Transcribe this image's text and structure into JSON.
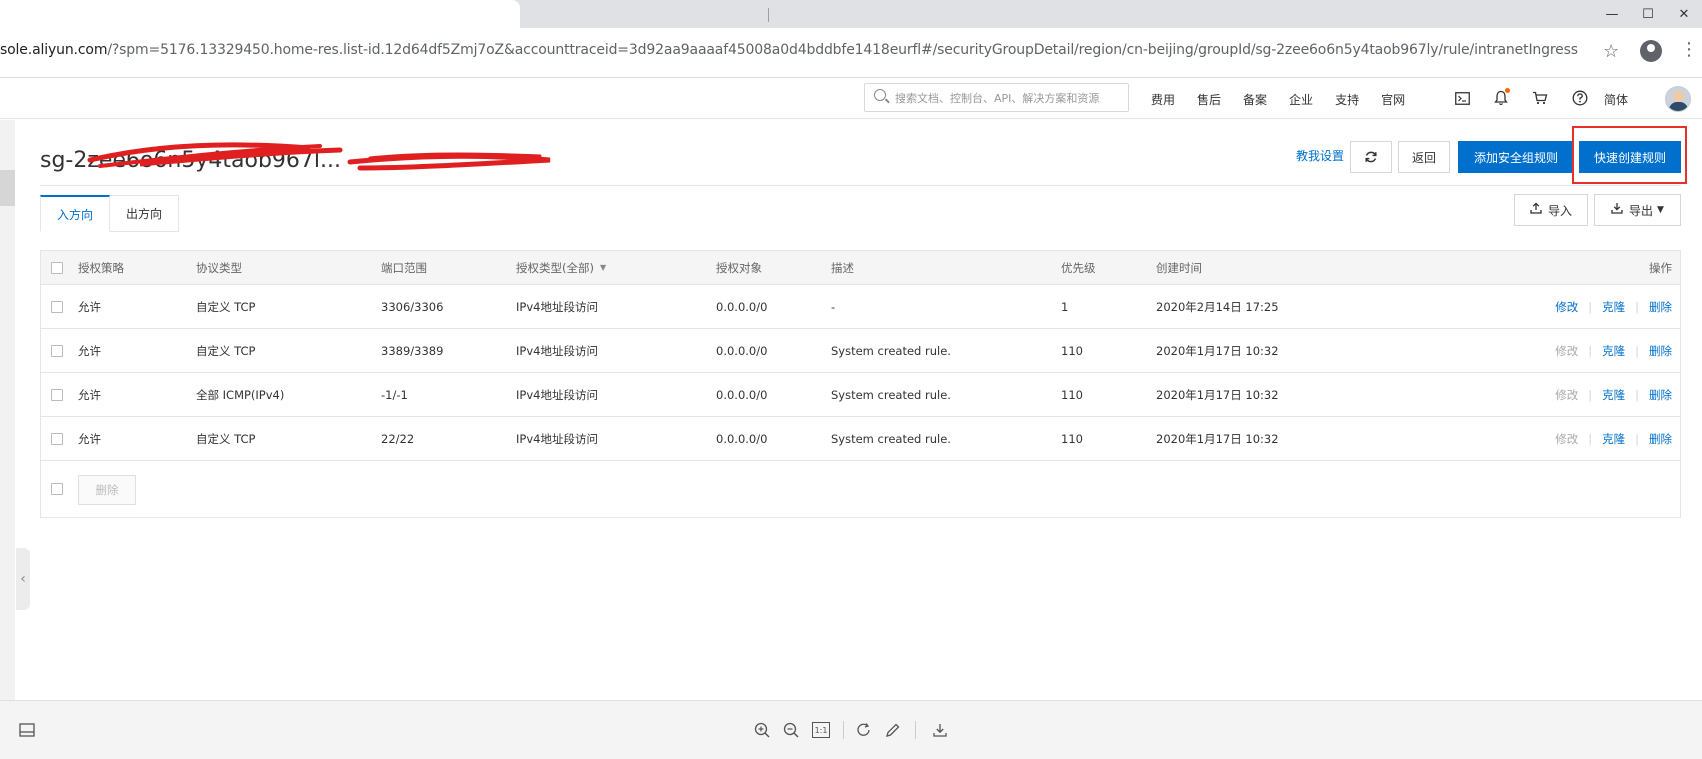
{
  "browser": {
    "url_host": "sole.aliyun.com",
    "url_rest": "/?spm=5176.13329450.home-res.list-id.12d64df5Zmj7oZ&accounttraceid=3d92aa9aaaaf45008a0d4bddbfe1418eurfl#/securityGroupDetail/region/cn-beijing/groupId/sg-2zee6o6n5y4taob967ly/rule/intranetIngress",
    "window_controls": [
      "—",
      "☐",
      "✕"
    ]
  },
  "topnav": {
    "search_placeholder": "搜索文档、控制台、API、解决方案和资源",
    "items": [
      "费用",
      "售后",
      "备案",
      "企业",
      "支持",
      "官网"
    ],
    "language": "简体"
  },
  "header": {
    "title": "sg-2zee6o6n5y4taob967l...",
    "help_link": "教我设置",
    "back": "返回",
    "add_rule": "添加安全组规则",
    "quick_rule": "快速创建规则",
    "highlight_color": "#e5312a"
  },
  "tabs": {
    "inbound": "入方向",
    "outbound": "出方向"
  },
  "actions": {
    "import": "导入",
    "export": "导出"
  },
  "table": {
    "columns": {
      "policy": "授权策略",
      "protocol": "协议类型",
      "port": "端口范围",
      "auth_type": "授权类型(全部)",
      "auth_object": "授权对象",
      "desc": "描述",
      "priority": "优先级",
      "created": "创建时间",
      "ops": "操作"
    },
    "rows": [
      {
        "policy": "允许",
        "protocol": "自定义 TCP",
        "port": "3306/3306",
        "auth_type": "IPv4地址段访问",
        "auth_object": "0.0.0.0/0",
        "desc": "-",
        "priority": "1",
        "created": "2020年2月14日 17:25",
        "edit": "修改",
        "clone": "克隆",
        "delete": "删除",
        "edit_disabled": false
      },
      {
        "policy": "允许",
        "protocol": "自定义 TCP",
        "port": "3389/3389",
        "auth_type": "IPv4地址段访问",
        "auth_object": "0.0.0.0/0",
        "desc": "System created rule.",
        "priority": "110",
        "created": "2020年1月17日 10:32",
        "edit": "修改",
        "clone": "克隆",
        "delete": "删除",
        "edit_disabled": true
      },
      {
        "policy": "允许",
        "protocol": "全部 ICMP(IPv4)",
        "port": "-1/-1",
        "auth_type": "IPv4地址段访问",
        "auth_object": "0.0.0.0/0",
        "desc": "System created rule.",
        "priority": "110",
        "created": "2020年1月17日 10:32",
        "edit": "修改",
        "clone": "克隆",
        "delete": "删除",
        "edit_disabled": true
      },
      {
        "policy": "允许",
        "protocol": "自定义 TCP",
        "port": "22/22",
        "auth_type": "IPv4地址段访问",
        "auth_object": "0.0.0.0/0",
        "desc": "System created rule.",
        "priority": "110",
        "created": "2020年1月17日 10:32",
        "edit": "修改",
        "clone": "克隆",
        "delete": "删除",
        "edit_disabled": true
      }
    ],
    "batch_delete": "删除"
  },
  "bottom_toolbar": {
    "fit_label": "1:1"
  }
}
